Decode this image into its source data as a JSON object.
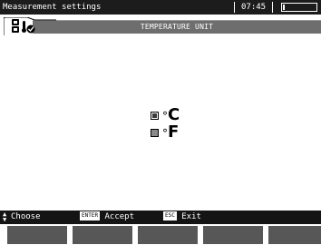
{
  "titlebar": {
    "title": "Measurement settings",
    "time": "07:45",
    "battery_level": 0.05
  },
  "header": {
    "section_title": "TEMPERATURE UNIT",
    "icons": [
      "settings-icon",
      "thermometer-icon",
      "check-icon"
    ]
  },
  "units": [
    {
      "symbol": "C",
      "degree": "°",
      "selected": true
    },
    {
      "symbol": "F",
      "degree": "°",
      "selected": false
    }
  ],
  "hints": {
    "choose_label": "Choose",
    "enter_key": "ENTER",
    "accept_label": "Accept",
    "esc_key": "ESC",
    "exit_label": "Exit"
  },
  "function_keys": [
    "",
    "",
    "",
    "",
    ""
  ]
}
